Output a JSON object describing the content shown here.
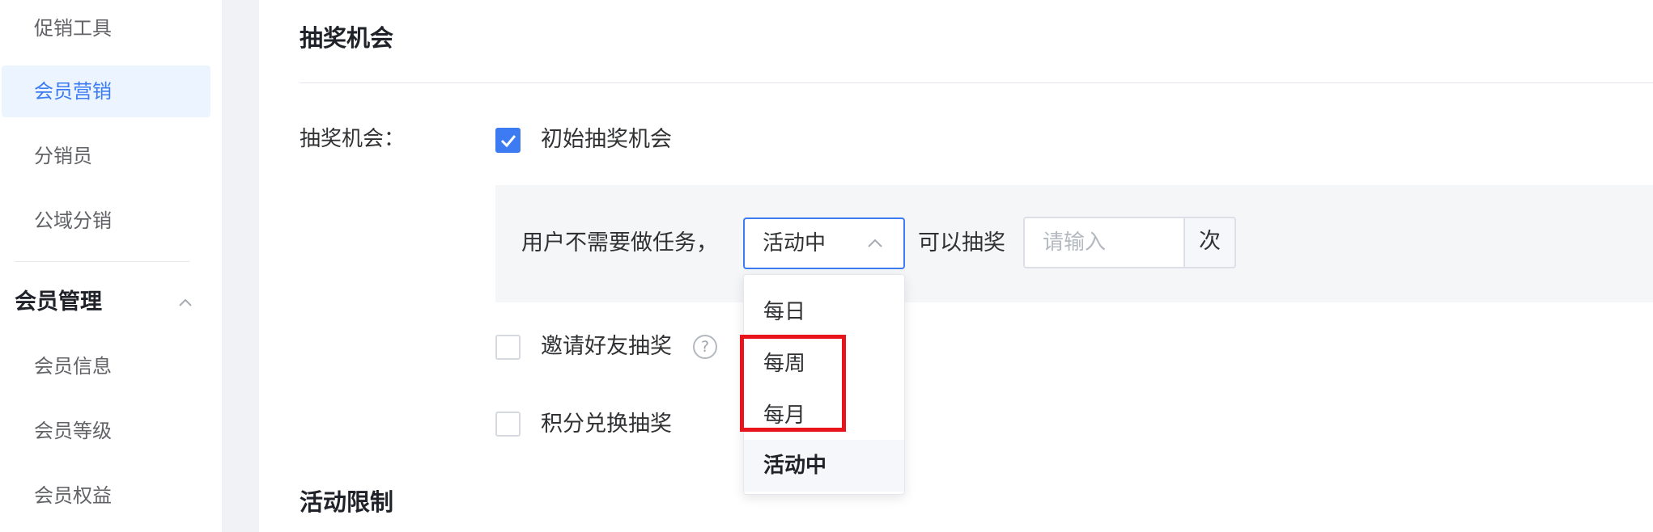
{
  "sidebar": {
    "items": [
      {
        "label": "促销工具"
      },
      {
        "label": "会员营销",
        "active": true
      },
      {
        "label": "分销员"
      },
      {
        "label": "公域分销"
      }
    ],
    "group": {
      "label": "会员管理",
      "expanded": true,
      "icon": "chevron-up-icon"
    },
    "sub_items": [
      {
        "label": "会员信息"
      },
      {
        "label": "会员等级"
      },
      {
        "label": "会员权益"
      }
    ]
  },
  "main": {
    "section_title": "抽奖机会",
    "form_label": "抽奖机会：",
    "initial_chance": {
      "label": "初始抽奖机会",
      "checked": true
    },
    "panel": {
      "prefix_text": "用户不需要做任务，",
      "period_select": {
        "value": "活动中",
        "options": [
          "每日",
          "每周",
          "每月",
          "活动中"
        ],
        "selected": "活动中"
      },
      "middle_text": "可以抽奖",
      "count_input": {
        "value": "",
        "placeholder": "请输入"
      },
      "suffix": "次"
    },
    "invite_friend": {
      "label": "邀请好友抽奖",
      "checked": false,
      "help_icon": "question-circle-icon",
      "help_glyph": "?"
    },
    "points_exchange": {
      "label": "积分兑换抽奖",
      "checked": false
    },
    "section2_title": "活动限制"
  },
  "colors": {
    "accent": "#3c7bf2",
    "highlight": "#e8141c",
    "active_bg": "#ecf5ff"
  }
}
